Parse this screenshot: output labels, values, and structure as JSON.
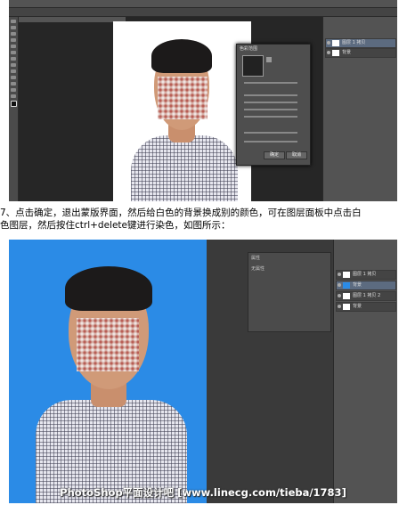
{
  "screenshot_1": {
    "dialog_title": "色彩范围",
    "dialog_buttons": [
      "确定",
      "取消"
    ],
    "layers": [
      "图层 1 拷贝",
      "背景"
    ],
    "canvas_background": "#ffffff"
  },
  "caption": {
    "line1": "7、点击确定，退出蒙版界面，然后给白色的背景换成别的颜色，可在图层面板中点击白",
    "line2": "色图层，然后按住ctrl+delete键进行染色，如图所示："
  },
  "screenshot_2": {
    "panel_title": "属性",
    "panel_sub": "无属性",
    "layers": [
      "图层 1 拷贝",
      "背景",
      "图层 1 拷贝 2",
      "背景"
    ],
    "canvas_background": "#2b8be6"
  },
  "watermark": "PhotoShop平面设计吧 [www.linecg.com/tieba/1783]",
  "colors": {
    "ps_dark": "#3a3a3a",
    "blue_bg": "#2b8be6",
    "selected_layer": "#5c6b80"
  },
  "icons": [
    "move-icon",
    "marquee-icon",
    "lasso-icon",
    "brush-icon",
    "eye-icon"
  ]
}
